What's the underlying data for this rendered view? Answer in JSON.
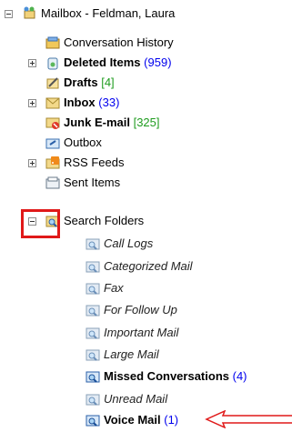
{
  "root": {
    "label": "Mailbox - Feldman, Laura"
  },
  "folders": [
    {
      "label": "Conversation History",
      "count": ""
    },
    {
      "label": "Deleted Items",
      "count": "(959)"
    },
    {
      "label": "Drafts",
      "count": "[4]"
    },
    {
      "label": "Inbox",
      "count": "(33)"
    },
    {
      "label": "Junk E-mail",
      "count": "[325]"
    },
    {
      "label": "Outbox",
      "count": ""
    },
    {
      "label": "RSS Feeds",
      "count": ""
    },
    {
      "label": "Sent Items",
      "count": ""
    },
    {
      "label": "Search Folders",
      "count": ""
    }
  ],
  "search_folders": [
    {
      "label": "Call Logs",
      "count": ""
    },
    {
      "label": "Categorized Mail",
      "count": ""
    },
    {
      "label": "Fax",
      "count": ""
    },
    {
      "label": "For Follow Up",
      "count": ""
    },
    {
      "label": "Important Mail",
      "count": ""
    },
    {
      "label": "Large Mail",
      "count": ""
    },
    {
      "label": "Missed Conversations",
      "count": "(4)"
    },
    {
      "label": "Unread Mail",
      "count": ""
    },
    {
      "label": "Voice Mail",
      "count": "(1)"
    }
  ],
  "colors": {
    "unread_count": "#0000ee",
    "draft_count": "#1f9c1f",
    "annotation": "#e01919"
  }
}
